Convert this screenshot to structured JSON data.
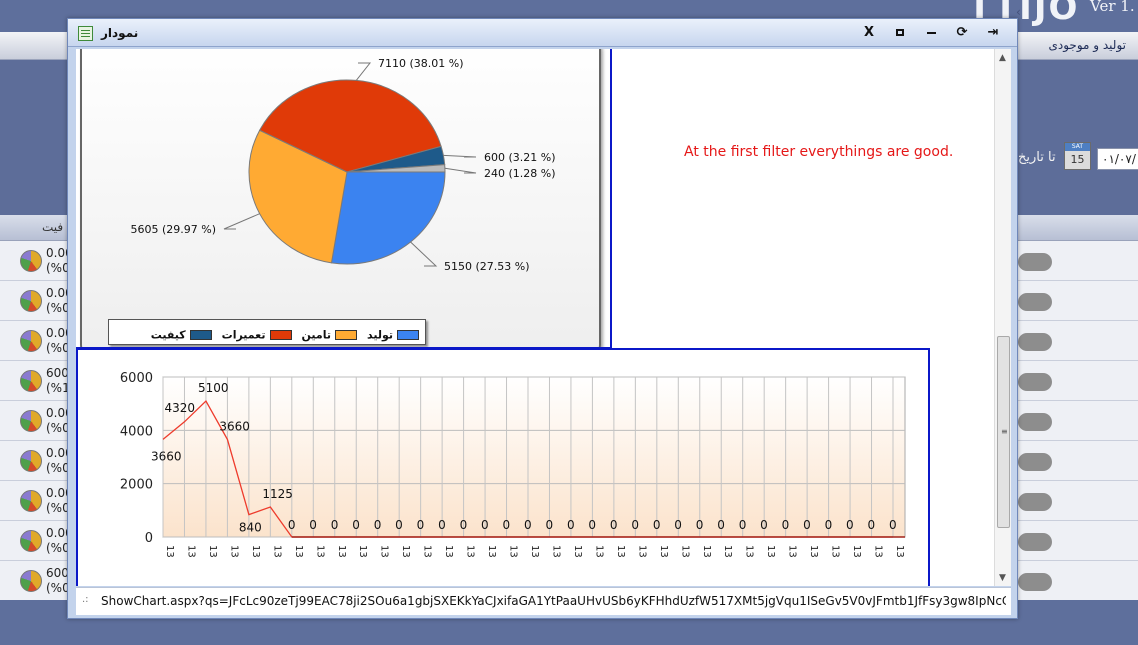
{
  "background_app": {
    "logo_text": "TTIJO",
    "version_text": "Ver 1.",
    "menu_item": "تولید و موجودی",
    "filter_label": "تا تاریخ",
    "calendar": {
      "day_name": "SAT",
      "day_number": "15"
    },
    "date_value": "۰۱/۰۷/",
    "column_header": "فیت",
    "rows": [
      {
        "v1": "0.00",
        "v2": "(%0"
      },
      {
        "v1": "0.00",
        "v2": "(%0"
      },
      {
        "v1": "0.00",
        "v2": "(%0"
      },
      {
        "v1": "600",
        "v2": "(%1"
      },
      {
        "v1": "0.00",
        "v2": "(%0"
      },
      {
        "v1": "0.00",
        "v2": "(%0"
      },
      {
        "v1": "0.00",
        "v2": "(%0"
      },
      {
        "v1": "0.00",
        "v2": "(%0"
      },
      {
        "v1": "600",
        "v2": "(%0"
      }
    ]
  },
  "popup": {
    "title": "نمودار",
    "buttons": {
      "close": "X",
      "refresh": "⟳",
      "pin": "⇥"
    },
    "note": "At the first filter everythings are good.",
    "status_text": "ShowChart.aspx?qs=JFcLc90zeTj99EAC78ji2SOu6a1gbjSXEKkYaCJxifaGA1YtPaaUHvUSb6yKFHhdUzfW517XMt5jgVqu1ISeGv5V0vJFmtb1JfFsy3gw8IpNcCUtPKL6yVWs8D307QI..."
  },
  "colors": {
    "tolid": "#3b83f0",
    "tamin": "#ffaa33",
    "tamirat": "#e03a08",
    "keyfiat": "#1e5a8a",
    "sayer": "#bbbbbb",
    "line": "#ee3b2c",
    "note": "#e51818",
    "frame": "#0b18c8"
  },
  "chart_data": [
    {
      "type": "pie",
      "slices": [
        {
          "key": "tolid",
          "name": "تولید",
          "value": 5150,
          "label": "5150 (27.53 %)"
        },
        {
          "key": "tamin",
          "name": "تامین",
          "value": 5605,
          "label": "5605 (29.97 %)"
        },
        {
          "key": "tamirat",
          "name": "تعمیرات",
          "value": 7110,
          "label": "7110 (38.01 %)"
        },
        {
          "key": "keyfiat",
          "name": "کیفیت",
          "value": 600,
          "label": "600 (3.21 %)"
        },
        {
          "key": "sayer",
          "name": "سایر",
          "value": 240,
          "label": "240 (1.28 %)"
        }
      ],
      "legend_position": "bottom-left"
    },
    {
      "type": "line",
      "x_tick_label": "13",
      "values": [
        3660,
        4320,
        5100,
        3660,
        840,
        1125,
        0,
        0,
        0,
        0,
        0,
        0,
        0,
        0,
        0,
        0,
        0,
        0,
        0,
        0,
        0,
        0,
        0,
        0,
        0,
        0,
        0,
        0,
        0,
        0,
        0,
        0,
        0,
        0,
        0
      ],
      "ylim": [
        0,
        6000
      ],
      "y_ticks": [
        0,
        2000,
        4000,
        6000
      ],
      "grid": true
    }
  ]
}
